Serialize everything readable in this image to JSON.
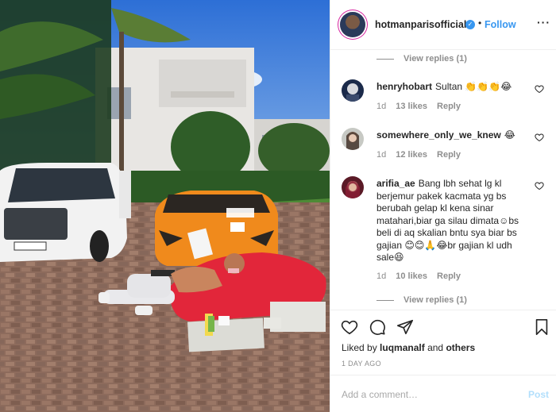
{
  "header": {
    "username": "hotmanparisofficial",
    "verified_icon": "verified-badge-icon",
    "separator": "•",
    "follow_label": "Follow",
    "more_label": "···"
  },
  "comments": {
    "view_replies_top": "View replies (1)",
    "items": [
      {
        "username": "henryhobart",
        "text": "Sultan 👏👏👏😂",
        "time": "1d",
        "likes": "13 likes",
        "reply": "Reply"
      },
      {
        "username": "somewhere_only_we_knew",
        "text": "😂",
        "time": "1d",
        "likes": "12 likes",
        "reply": "Reply"
      },
      {
        "username": "arifia_ae",
        "text": "Bang lbh sehat lg kl berjemur pakek kacmata yg bs berubah gelap kl kena sinar matahari,biar ga silau dimata☺bs beli di aq skalian bntu sya biar bs gajian 😊😊🙏😂br gajian kl udh sale😆",
        "time": "1d",
        "likes": "10 likes",
        "reply": "Reply"
      }
    ],
    "view_replies_bottom": "View replies (1)"
  },
  "actions": {
    "liked_prefix": "Liked by",
    "liked_user": "luqmanalf",
    "liked_and": "and",
    "liked_others": "others",
    "date": "1 DAY AGO"
  },
  "add_comment": {
    "placeholder": "Add a comment…",
    "post_label": "Post"
  },
  "colors": {
    "link_blue": "#3897f0",
    "muted": "#8e8e8e",
    "post_disabled": "#b2dffc"
  }
}
